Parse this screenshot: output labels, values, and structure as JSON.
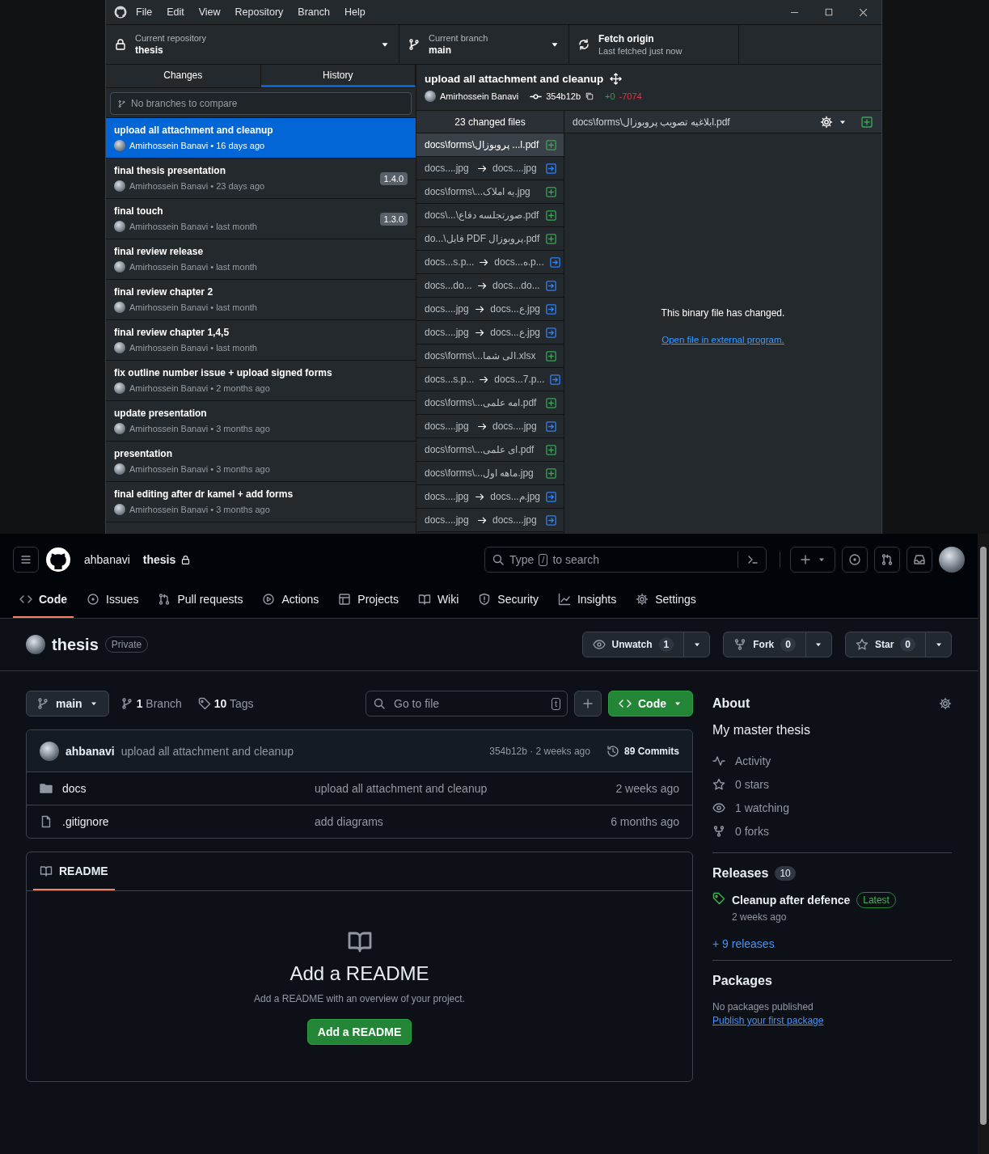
{
  "desktop": {
    "menu": [
      "File",
      "Edit",
      "View",
      "Repository",
      "Branch",
      "Help"
    ],
    "repository": {
      "label": "Current repository",
      "value": "thesis"
    },
    "branch": {
      "label": "Current branch",
      "value": "main"
    },
    "fetch": {
      "label": "Fetch origin",
      "detail": "Last fetched just now"
    },
    "tabs": [
      {
        "label": "Changes",
        "selected": false
      },
      {
        "label": "History",
        "selected": true
      }
    ],
    "branch_filter": {
      "placeholder": "No branches to compare"
    },
    "commits": [
      {
        "title": "upload all attachment and cleanup",
        "byline": "Amirhossein Banavi • 16 days ago",
        "selected": true
      },
      {
        "title": "final thesis presentation",
        "byline": "Amirhossein Banavi • 23 days ago",
        "tag": "1.4.0",
        "selected": false
      },
      {
        "title": "final touch",
        "byline": "Amirhossein Banavi • last month",
        "tag": "1.3.0",
        "selected": false
      },
      {
        "title": "final review release",
        "byline": "Amirhossein Banavi • last month",
        "selected": false
      },
      {
        "title": "final review chapter 2",
        "byline": "Amirhossein Banavi • last month",
        "selected": false
      },
      {
        "title": "final review chapter 1,4,5",
        "byline": "Amirhossein Banavi • last month",
        "selected": false
      },
      {
        "title": "fix outline number issue + upload signed forms",
        "byline": "Amirhossein Banavi • 2 months ago",
        "selected": false
      },
      {
        "title": "update presentation",
        "byline": "Amirhossein Banavi • 3 months ago",
        "selected": false
      },
      {
        "title": "presentation",
        "byline": "Amirhossein Banavi • 3 months ago",
        "selected": false
      },
      {
        "title": "final editing after dr kamel + add forms",
        "byline": "Amirhossein Banavi • 3 months ago",
        "selected": false
      }
    ],
    "commit_detail": {
      "title": "upload all attachment and cleanup",
      "author": "Amirhossein Banavi",
      "sha": "354b12b",
      "added": "+0",
      "removed": "-7074"
    },
    "changed_files": "23 changed files",
    "files": [
      {
        "kind": "added",
        "path": "docs\\forms\\ا... پروبوزال.pdf",
        "selected": true
      },
      {
        "kind": "renamed",
        "from": "docs....jpg",
        "to": "docs....jpg",
        "selected": false
      },
      {
        "kind": "added",
        "path": "docs\\forms\\...یه املاک.jpg",
        "selected": false
      },
      {
        "kind": "added",
        "path": "docs\\...\\صورتجلسه دفاع.pdf",
        "selected": false
      },
      {
        "kind": "added",
        "path": "do...\\فایل PDF پروبوزال.pdf",
        "selected": false
      },
      {
        "kind": "renamed",
        "from": "docs...s.p...",
        "to": "docs...ه.p...",
        "selected": false
      },
      {
        "kind": "renamed",
        "from": "docs...do...",
        "to": "docs...do...",
        "selected": false
      },
      {
        "kind": "renamed",
        "from": "docs....jpg",
        "to": "docs...ع.jpg",
        "selected": false
      },
      {
        "kind": "renamed",
        "from": "docs....jpg",
        "to": "docs...ع.jpg",
        "selected": false
      },
      {
        "kind": "added",
        "path": "docs\\forms\\...الی شما.xlsx",
        "selected": false
      },
      {
        "kind": "renamed",
        "from": "docs...s.p...",
        "to": "docs...7.p...",
        "selected": false
      },
      {
        "kind": "added",
        "path": "docs\\forms\\...امه علمی.pdf",
        "selected": false
      },
      {
        "kind": "renamed",
        "from": "docs....jpg",
        "to": "docs....jpg",
        "selected": false
      },
      {
        "kind": "added",
        "path": "docs\\forms\\...ای علمی.pdf",
        "selected": false
      },
      {
        "kind": "added",
        "path": "docs\\forms\\...ماهه اول.jpg",
        "selected": false
      },
      {
        "kind": "renamed",
        "from": "docs....jpg",
        "to": "docs...م.jpg",
        "selected": false
      },
      {
        "kind": "renamed",
        "from": "docs....jpg",
        "to": "docs....jpg",
        "selected": false
      }
    ],
    "diff": {
      "path": "docs\\forms\\ابلاغیه تصویب پروبوزال.pdf",
      "message": "This binary file has changed.",
      "link": "Open file in external program."
    }
  },
  "web": {
    "owner": "ahbanavi",
    "repo": "thesis",
    "search": {
      "before": "Type",
      "key": "/",
      "after": "to search"
    },
    "nav": [
      {
        "label": "Code",
        "selected": true
      },
      {
        "label": "Issues",
        "selected": false
      },
      {
        "label": "Pull requests",
        "selected": false
      },
      {
        "label": "Actions",
        "selected": false
      },
      {
        "label": "Projects",
        "selected": false
      },
      {
        "label": "Wiki",
        "selected": false
      },
      {
        "label": "Security",
        "selected": false
      },
      {
        "label": "Insights",
        "selected": false
      },
      {
        "label": "Settings",
        "selected": false
      }
    ],
    "title": {
      "name": "thesis",
      "visibility": "Private"
    },
    "actions": [
      {
        "label": "Unwatch",
        "count": "1"
      },
      {
        "label": "Fork",
        "count": "0"
      },
      {
        "label": "Star",
        "count": "0"
      }
    ],
    "branch_button": "main",
    "branches": "**1** Branch",
    "tags": "**10** Tags",
    "file_search": {
      "placeholder": "Go to file",
      "key": "t"
    },
    "code_button": "Code",
    "latest_commit": {
      "author": "ahbanavi",
      "message": "upload all attachment and cleanup",
      "meta": "354b12b · 2 weeks ago",
      "commits": "89 Commits"
    },
    "files": [
      {
        "kind": "folder",
        "name": "docs",
        "message": "upload all attachment and cleanup",
        "time": "2 weeks ago"
      },
      {
        "kind": "file",
        "name": ".gitignore",
        "message": "add diagrams",
        "time": "6 months ago"
      }
    ],
    "readme": {
      "tab": "README",
      "title": "Add a README",
      "text": "Add a README with an overview of your project.",
      "button": "Add a README"
    },
    "about": {
      "heading": "About",
      "description": "My master thesis",
      "stats": [
        {
          "kind": "activity",
          "label": "Activity"
        },
        {
          "kind": "stars",
          "label": "0 stars"
        },
        {
          "kind": "watching",
          "label": "1 watching"
        },
        {
          "kind": "forks",
          "label": "0 forks"
        }
      ]
    },
    "releases": {
      "heading": "Releases",
      "count": "10",
      "name": "Cleanup after defence",
      "badge": "Latest",
      "time": "2 weeks ago",
      "more": "+ 9 releases"
    },
    "packages": {
      "heading": "Packages",
      "text": "No packages published",
      "link": "Publish your first package"
    }
  }
}
